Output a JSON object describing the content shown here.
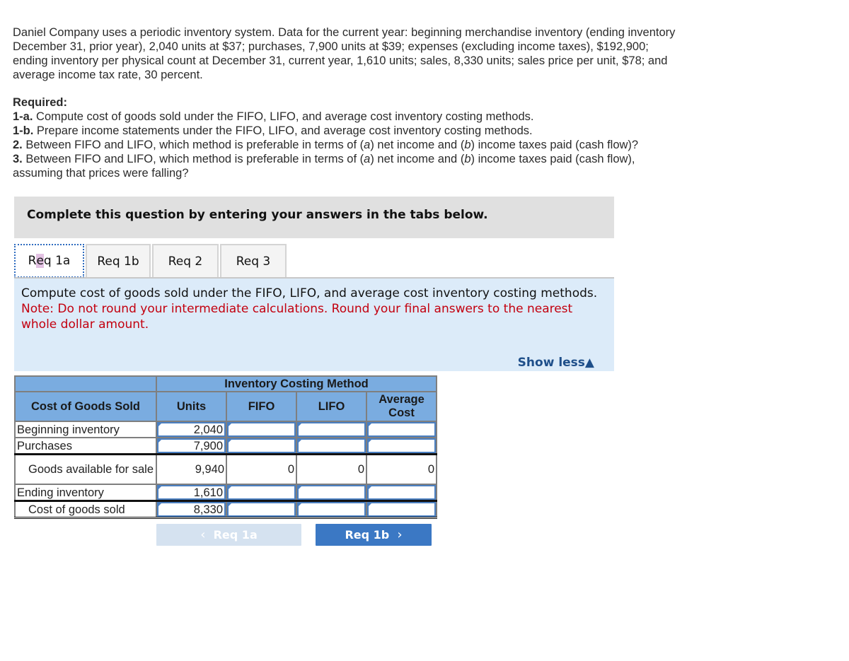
{
  "problem": {
    "intro": "Daniel Company uses a periodic inventory system. Data for the current year: beginning merchandise inventory (ending inventory December 31, prior year), 2,040 units at $37; purchases, 7,900 units at $39; expenses (excluding income taxes), $192,900; ending inventory per physical count at December 31, current year, 1,610 units; sales, 8,330 units; sales price per unit, $78; and average income tax rate, 30 percent.",
    "required_heading": "Required:",
    "requirements": [
      {
        "num": "1-a.",
        "text": " Compute cost of goods sold under the FIFO, LIFO, and average cost inventory costing methods."
      },
      {
        "num": "1-b.",
        "text": " Prepare income statements under the FIFO, LIFO, and average cost inventory costing methods."
      },
      {
        "num": "2.",
        "text_a": " Between FIFO and LIFO, which method is preferable in terms of (",
        "a": "a",
        "text_b": ") net income and (",
        "b": "b",
        "text_c": ") income taxes paid (cash flow)?"
      },
      {
        "num": "3.",
        "text_a": " Between FIFO and LIFO, which method is preferable in terms of (",
        "a": "a",
        "text_b": ") net income and (",
        "b": "b",
        "text_c": ") income taxes paid (cash flow), assuming that prices were falling?"
      }
    ]
  },
  "banner": "Complete this question by entering your answers in the tabs below.",
  "tabs": [
    {
      "label_pre": "R",
      "label_hl": "e",
      "label_post": "q 1a",
      "active": true
    },
    {
      "label": "Req 1b"
    },
    {
      "label": "Req 2"
    },
    {
      "label": "Req 3"
    }
  ],
  "panel": {
    "instruction": "Compute cost of goods sold under the FIFO, LIFO, and average cost inventory costing methods.",
    "note": "Note: Do not round your intermediate calculations. Round your final answers to the nearest whole dollar amount.",
    "show_less": "Show less",
    "show_less_icon": "▲"
  },
  "table": {
    "group_header": "Inventory Costing Method",
    "headers": [
      "Cost of Goods Sold",
      "Units",
      "FIFO",
      "LIFO",
      "Average Cost"
    ],
    "rows": [
      {
        "label": "Beginning inventory",
        "units": "2,040",
        "fifo": "",
        "lifo": "",
        "avg": ""
      },
      {
        "label": "Purchases",
        "units": "7,900",
        "fifo": "",
        "lifo": "",
        "avg": ""
      },
      {
        "label": "Goods available for sale",
        "units": "9,940",
        "fifo": "0",
        "lifo": "0",
        "avg": "0"
      },
      {
        "label": "Ending inventory",
        "units": "1,610",
        "fifo": "",
        "lifo": "",
        "avg": ""
      },
      {
        "label": "Cost of goods sold",
        "units": "8,330",
        "fifo": "",
        "lifo": "",
        "avg": ""
      }
    ]
  },
  "nav": {
    "prev_label": "Req 1a",
    "prev_icon": "‹",
    "next_label": "Req 1b",
    "next_icon": "›"
  },
  "colors": {
    "header_blue": "#7aace0",
    "panel_bg": "#dcebf9",
    "note_red": "#c3000f",
    "link_blue": "#1f4f8a",
    "next_button": "#3b78c4",
    "prev_button_disabled": "#d5e2f0"
  }
}
